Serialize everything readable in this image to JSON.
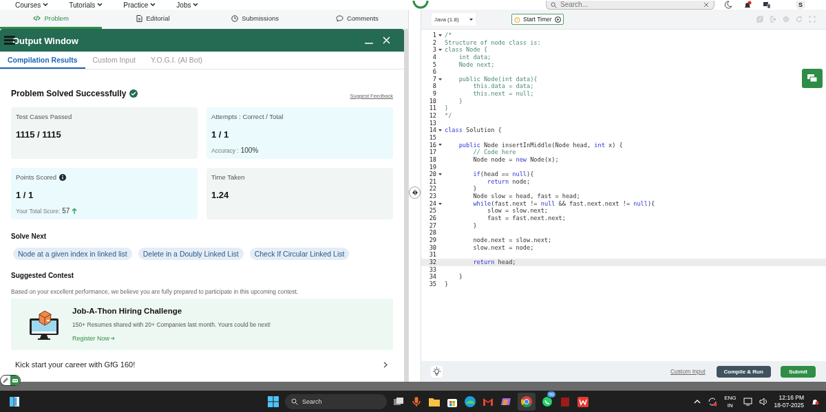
{
  "top_nav": {
    "items": [
      "Courses",
      "Tutorials",
      "Practice",
      "Jobs"
    ],
    "search": {
      "placeholder": "Search..."
    },
    "avatar": "S"
  },
  "problem_tabs": [
    {
      "label": "Problem",
      "selected": true
    },
    {
      "label": "Editorial",
      "selected": false
    },
    {
      "label": "Submissions",
      "selected": false
    },
    {
      "label": "Comments",
      "selected": false
    }
  ],
  "output_window": {
    "title": "Output Window",
    "tabs": [
      {
        "label": "Compilation Results",
        "selected": true
      },
      {
        "label": "Custom Input",
        "selected": false
      },
      {
        "label": "Y.O.G.I. (AI Bot)",
        "selected": false
      }
    ],
    "result": {
      "title": "Problem Solved Successfully",
      "feedback_link": "Suggest Feedback",
      "stats": [
        {
          "label": "Test Cases Passed",
          "value": "1115 / 1115",
          "color": "#f1f5f4"
        },
        {
          "label": "Attempts : Correct / Total",
          "value": "1 / 1",
          "note_label": "Accuracy :",
          "note_value": "100%",
          "color": "#ebfafd"
        },
        {
          "label": "Points Scored",
          "value": "1 / 1",
          "info": true,
          "note_label": "Your Total Score:",
          "note_value": "57",
          "trend_up": true,
          "color": "#ebfafd"
        },
        {
          "label": "Time Taken",
          "value": "1.24",
          "color": "#f1f5f4"
        }
      ]
    },
    "solve_next": {
      "heading": "Solve Next",
      "items": [
        "Node at a given index in linked list",
        "Delete in a Doubly Linked List",
        "Check If Circular Linked List"
      ]
    },
    "suggested_contest": {
      "heading": "Suggested Contest",
      "description": "Based on your excellent performance, we believe you are fully prepared to participate in this upcoming contest.",
      "card": {
        "title": "Job-A-Thon Hiring Challenge",
        "text": "150+ Resumes shared with 20+ Companies last month. Yours could be next!",
        "link": "Register Now"
      }
    },
    "promo": "Kick start your career with GfG 160!"
  },
  "editor": {
    "language": "Java (1.8)",
    "timer_button": "Start Timer",
    "lines": [
      {
        "number": "1",
        "foldable": true,
        "current": false,
        "tokens": [
          {
            "kind": "comment",
            "text": "/*"
          }
        ]
      },
      {
        "number": "2",
        "foldable": false,
        "current": false,
        "tokens": [
          {
            "kind": "comment",
            "text": "Structure of node class is:"
          }
        ]
      },
      {
        "number": "3",
        "foldable": true,
        "current": false,
        "tokens": [
          {
            "kind": "comment",
            "text": "class Node {"
          }
        ]
      },
      {
        "number": "4",
        "foldable": false,
        "current": false,
        "tokens": [
          {
            "kind": "comment",
            "text": "    int data;"
          }
        ]
      },
      {
        "number": "5",
        "foldable": false,
        "current": false,
        "tokens": [
          {
            "kind": "comment",
            "text": "    Node next;"
          }
        ]
      },
      {
        "number": "6",
        "foldable": false,
        "current": false
      },
      {
        "number": "7",
        "foldable": true,
        "current": false,
        "tokens": [
          {
            "kind": "comment",
            "text": "    public Node(int data){"
          }
        ]
      },
      {
        "number": "8",
        "foldable": false,
        "current": false,
        "tokens": [
          {
            "kind": "comment",
            "text": "        this.data = data;"
          }
        ]
      },
      {
        "number": "9",
        "foldable": false,
        "current": false,
        "tokens": [
          {
            "kind": "comment",
            "text": "        this.next = null;"
          }
        ]
      },
      {
        "number": "10",
        "foldable": false,
        "current": false,
        "tokens": [
          {
            "kind": "comment",
            "text": "    }"
          }
        ]
      },
      {
        "number": "11",
        "foldable": false,
        "current": false,
        "tokens": [
          {
            "kind": "comment",
            "text": "}"
          }
        ]
      },
      {
        "number": "12",
        "foldable": false,
        "current": false,
        "tokens": [
          {
            "kind": "comment",
            "text": "*/"
          }
        ]
      },
      {
        "number": "13",
        "foldable": false,
        "current": false
      },
      {
        "number": "14",
        "foldable": true,
        "current": false,
        "tokens": [
          {
            "kind": "keyword",
            "text": "class"
          },
          {
            "kind": "plain",
            "text": " Solution {"
          }
        ]
      },
      {
        "number": "15",
        "foldable": false,
        "current": false
      },
      {
        "number": "16",
        "foldable": true,
        "current": false,
        "tokens": [
          {
            "kind": "keyword",
            "text": "    public"
          },
          {
            "kind": "plain",
            "text": " Node insertInMiddle(Node head, "
          },
          {
            "kind": "keyword",
            "text": "int"
          },
          {
            "kind": "plain",
            "text": " x) {"
          }
        ]
      },
      {
        "number": "17",
        "foldable": false,
        "current": false,
        "tokens": [
          {
            "kind": "comment",
            "text": "        // Code here"
          }
        ]
      },
      {
        "number": "18",
        "foldable": false,
        "current": false,
        "tokens": [
          {
            "kind": "plain",
            "text": "        Node node = "
          },
          {
            "kind": "keyword",
            "text": "new"
          },
          {
            "kind": "plain",
            "text": " Node(x);"
          }
        ]
      },
      {
        "number": "19",
        "foldable": false,
        "current": false
      },
      {
        "number": "20",
        "foldable": true,
        "current": false,
        "tokens": [
          {
            "kind": "keyword",
            "text": "        if"
          },
          {
            "kind": "plain",
            "text": "(head == "
          },
          {
            "kind": "keyword",
            "text": "null"
          },
          {
            "kind": "plain",
            "text": "){"
          }
        ]
      },
      {
        "number": "21",
        "foldable": false,
        "current": false,
        "tokens": [
          {
            "kind": "keyword",
            "text": "            return"
          },
          {
            "kind": "plain",
            "text": " node;"
          }
        ]
      },
      {
        "number": "22",
        "foldable": false,
        "current": false,
        "tokens": [
          {
            "kind": "plain",
            "text": "        }"
          }
        ]
      },
      {
        "number": "23",
        "foldable": false,
        "current": false,
        "tokens": [
          {
            "kind": "plain",
            "text": "        Node slow = head, fast = head;"
          }
        ]
      },
      {
        "number": "24",
        "foldable": true,
        "current": false,
        "tokens": [
          {
            "kind": "keyword",
            "text": "        while"
          },
          {
            "kind": "plain",
            "text": "(fast.next != "
          },
          {
            "kind": "keyword",
            "text": "null"
          },
          {
            "kind": "plain",
            "text": " && fast.next.next != "
          },
          {
            "kind": "keyword",
            "text": "null"
          },
          {
            "kind": "plain",
            "text": "){"
          }
        ]
      },
      {
        "number": "25",
        "foldable": false,
        "current": false,
        "tokens": [
          {
            "kind": "plain",
            "text": "            slow = slow.next;"
          }
        ]
      },
      {
        "number": "26",
        "foldable": false,
        "current": false,
        "tokens": [
          {
            "kind": "plain",
            "text": "            fast = fast.next.next;"
          }
        ]
      },
      {
        "number": "27",
        "foldable": false,
        "current": false,
        "tokens": [
          {
            "kind": "plain",
            "text": "        }"
          }
        ]
      },
      {
        "number": "28",
        "foldable": false,
        "current": false
      },
      {
        "number": "29",
        "foldable": false,
        "current": false,
        "tokens": [
          {
            "kind": "plain",
            "text": "        node.next = slow.next;"
          }
        ]
      },
      {
        "number": "30",
        "foldable": false,
        "current": false,
        "tokens": [
          {
            "kind": "plain",
            "text": "        slow.next = node;"
          }
        ]
      },
      {
        "number": "31",
        "foldable": false,
        "current": false
      },
      {
        "number": "32",
        "foldable": false,
        "current": true,
        "tokens": [
          {
            "kind": "keyword",
            "text": "        return"
          },
          {
            "kind": "plain",
            "text": " head;"
          }
        ]
      },
      {
        "number": "33",
        "foldable": false,
        "current": false
      },
      {
        "number": "34",
        "foldable": false,
        "current": false,
        "tokens": [
          {
            "kind": "plain",
            "text": "    }"
          }
        ]
      },
      {
        "number": "35",
        "foldable": false,
        "current": false,
        "tokens": [
          {
            "kind": "plain",
            "text": "}"
          }
        ]
      }
    ],
    "footer": {
      "custom_input": "Custom Input",
      "compile_button": "Compile & Run",
      "submit_button": "Submit"
    }
  },
  "taskbar": {
    "search_placeholder": "Search",
    "badge": "99",
    "language": "ENG",
    "region": "IN",
    "time": "12:16 PM",
    "date": "18-07-2025"
  }
}
